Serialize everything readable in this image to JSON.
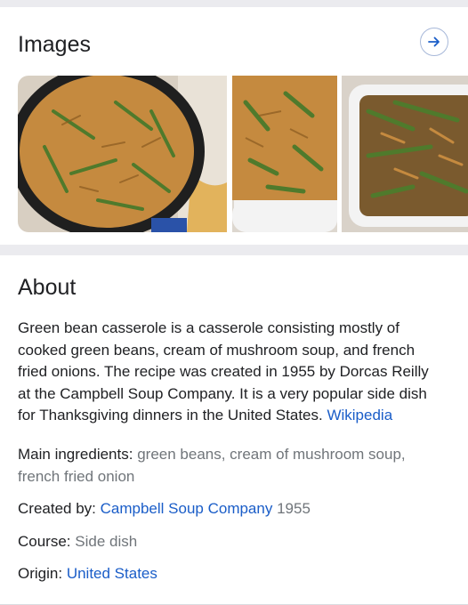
{
  "images": {
    "title": "Images",
    "thumbnails": [
      {
        "label": "green-bean-casserole-skillet"
      },
      {
        "label": "green-bean-casserole-dish"
      },
      {
        "label": "green-bean-casserole-baking-pan"
      }
    ],
    "colors": {
      "casserole": "#c58a3f",
      "beans": "#4f7a2c",
      "pan": "#1f1f1f",
      "dish": "#f3f3f3",
      "napkin": "#e2b35c"
    }
  },
  "about": {
    "title": "About",
    "description": "Green bean casserole is a casserole consisting mostly of cooked green beans, cream of mushroom soup, and french fried onions. The recipe was created in 1955 by Dorcas Reilly at the Campbell Soup Company. It is a very popular side dish for Thanksgiving dinners in the United States.",
    "source_link": "Wikipedia",
    "facts": {
      "main_ingredients": {
        "label": "Main ingredients:",
        "value": "green beans, cream of mushroom soup, french fried onion"
      },
      "created_by": {
        "label": "Created by:",
        "link": "Campbell Soup Company",
        "value": "1955"
      },
      "course": {
        "label": "Course:",
        "value": "Side dish"
      },
      "origin": {
        "label": "Origin:",
        "link": "United States"
      }
    }
  },
  "accent_color": "#1a5dc8"
}
